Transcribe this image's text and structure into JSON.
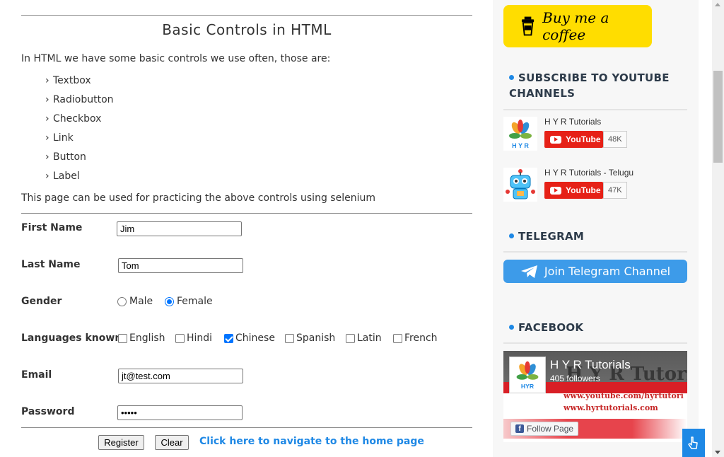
{
  "main": {
    "title": "Basic Controls in HTML",
    "intro": "In HTML we have some basic controls we use often, those are:",
    "controls": [
      "Textbox",
      "Radiobutton",
      "Checkbox",
      "Link",
      "Button",
      "Label"
    ],
    "practice_note": "This page can be used for practicing the above controls using selenium",
    "form": {
      "first_name_label": "First Name",
      "first_name_value": "Jim",
      "last_name_label": "Last Name",
      "last_name_value": "Tom",
      "gender_label": "Gender",
      "gender_options": [
        "Male",
        "Female"
      ],
      "gender_selected": "Female",
      "languages_label": "Languages known",
      "languages": [
        "English",
        "Hindi",
        "Chinese",
        "Spanish",
        "Latin",
        "French"
      ],
      "languages_checked": [
        "Chinese"
      ],
      "email_label": "Email",
      "email_value": "jt@test.com",
      "password_label": "Password",
      "password_value": "•••••",
      "register_label": "Register",
      "clear_label": "Clear"
    },
    "home_link": "Click here to navigate to the home page"
  },
  "sidebar": {
    "coffee_label": "Buy me a coffee",
    "youtube_title": "SUBSCRIBE TO YOUTUBE CHANNELS",
    "youtube_channels": [
      {
        "name": "H Y R Tutorials",
        "button": "YouTube",
        "subscribers": "48K"
      },
      {
        "name": "H Y R Tutorials - Telugu",
        "button": "YouTube",
        "subscribers": "47K"
      }
    ],
    "telegram_title": "TELEGRAM",
    "telegram_button": "Join Telegram Channel",
    "facebook_title": "FACEBOOK",
    "facebook": {
      "page_name": "H Y R Tutorials",
      "followers": "405 followers",
      "banner_title": "H Y R Tutoria",
      "banner_url1": "www.youtube.com/hyrtutori",
      "banner_url2": "www.hyrtutorials.com",
      "follow_button": "Follow Page",
      "logo_text": "HYR"
    }
  },
  "colors": {
    "accent": "#1e88e5",
    "coffee": "#ffdd00",
    "youtube": "#e62117",
    "telegram": "#3d9be9",
    "checkbox": "#0075ff"
  }
}
